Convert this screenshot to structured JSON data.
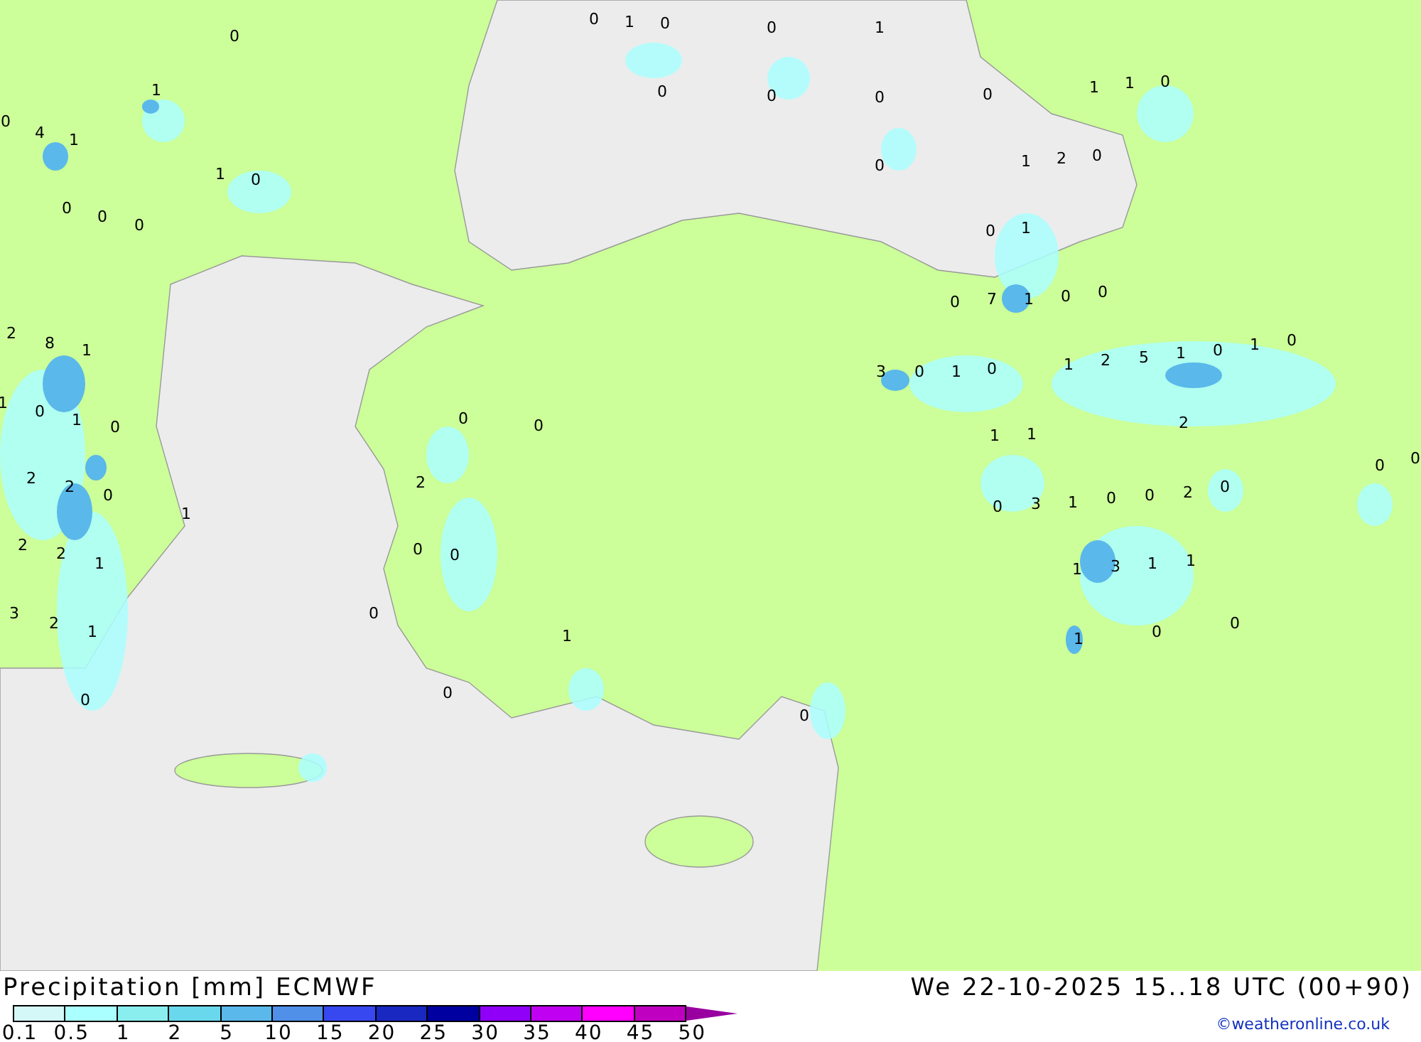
{
  "map": {
    "labels": [
      "0",
      "1",
      "0",
      "0",
      "1",
      "0",
      "1",
      "0",
      "0",
      "0",
      "0",
      "1",
      "1",
      "0",
      "0",
      "4",
      "1",
      "1",
      "2",
      "0",
      "1",
      "0",
      "0",
      "0",
      "0",
      "0",
      "0",
      "1",
      "0",
      "7",
      "1",
      "0",
      "0",
      "2",
      "8",
      "1",
      "3",
      "0",
      "1",
      "0",
      "1",
      "2",
      "5",
      "1",
      "0",
      "1",
      "0",
      "1",
      "0",
      "1",
      "0",
      "0",
      "0",
      "2",
      "1",
      "1",
      "0",
      "0",
      "2",
      "2",
      "0",
      "2",
      "2",
      "0",
      "0",
      "3",
      "1",
      "0",
      "0",
      "1",
      "2",
      "2",
      "1",
      "0",
      "0",
      "1",
      "3",
      "1",
      "1",
      "0",
      "3",
      "2",
      "1",
      "1",
      "1",
      "0",
      "0",
      "0",
      "0",
      "0"
    ]
  },
  "legend": {
    "title": "Precipitation [mm] ECMWF",
    "valid_time": "We 22-10-2025 15..18 UTC (00+90)",
    "credit": "©weatheronline.co.uk",
    "bins": [
      {
        "kind": "bin",
        "color": "#d4f7f7"
      },
      {
        "kind": "bin",
        "color": "#aaffff"
      },
      {
        "kind": "bin",
        "color": "#8aeeee"
      },
      {
        "kind": "bin",
        "color": "#6ad8ec"
      },
      {
        "kind": "bin",
        "color": "#5ab8ea"
      },
      {
        "kind": "bin",
        "color": "#5090e8"
      },
      {
        "kind": "bin",
        "color": "#3848f0"
      },
      {
        "kind": "bin",
        "color": "#1828c0"
      },
      {
        "kind": "bin",
        "color": "#0000a0"
      },
      {
        "kind": "bin",
        "color": "#9000f8"
      },
      {
        "kind": "bin",
        "color": "#c000f0"
      },
      {
        "kind": "bin",
        "color": "#ff00ff"
      },
      {
        "kind": "bin",
        "color": "#c000c0"
      },
      {
        "kind": "overflow",
        "color": "#9800a0"
      }
    ],
    "ticks": [
      "0.1",
      "0.5",
      "1",
      "2",
      "5",
      "10",
      "15",
      "20",
      "25",
      "30",
      "35",
      "40",
      "45",
      "50"
    ]
  }
}
